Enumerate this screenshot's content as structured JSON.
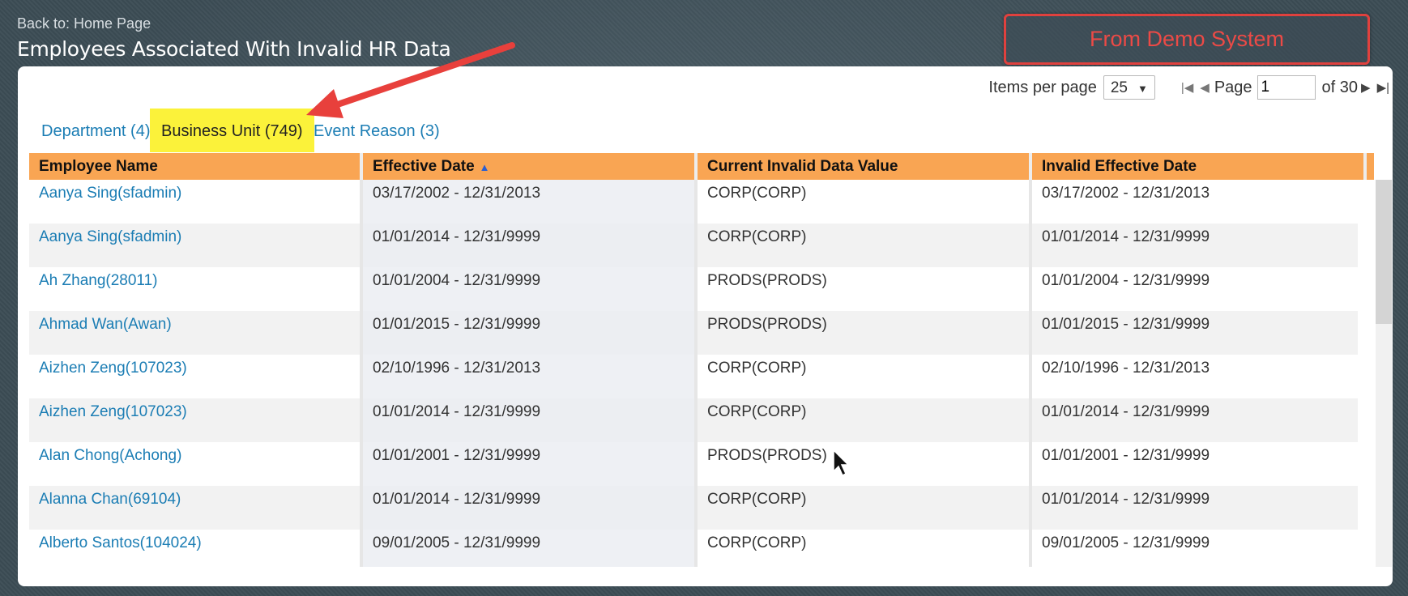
{
  "header": {
    "back_link": "Back to: Home Page",
    "title": "Employees Associated With Invalid HR Data",
    "banner": "From Demo System"
  },
  "pager": {
    "items_per_page_label": "Items per page",
    "items_per_page_value": "25",
    "page_label": "Page",
    "page_value": "1",
    "of_label": "of 30"
  },
  "tabs": [
    {
      "label": "Department (4)",
      "active": false
    },
    {
      "label": "Business Unit (749)",
      "active": true
    },
    {
      "label": "Event Reason (3)",
      "active": false
    }
  ],
  "table": {
    "columns": [
      "Employee Name",
      "Effective Date",
      "Current Invalid Data Value",
      "Invalid Effective Date"
    ],
    "sorted_column": "Effective Date",
    "sort_direction": "ascending",
    "rows": [
      [
        "Aanya Sing(sfadmin)",
        "03/17/2002 - 12/31/2013",
        "CORP(CORP)",
        "03/17/2002 - 12/31/2013"
      ],
      [
        "Aanya Sing(sfadmin)",
        "01/01/2014 - 12/31/9999",
        "CORP(CORP)",
        "01/01/2014 - 12/31/9999"
      ],
      [
        "Ah Zhang(28011)",
        "01/01/2004 - 12/31/9999",
        "PRODS(PRODS)",
        "01/01/2004 - 12/31/9999"
      ],
      [
        "Ahmad Wan(Awan)",
        "01/01/2015 - 12/31/9999",
        "PRODS(PRODS)",
        "01/01/2015 - 12/31/9999"
      ],
      [
        "Aizhen Zeng(107023)",
        "02/10/1996 - 12/31/2013",
        "CORP(CORP)",
        "02/10/1996 - 12/31/2013"
      ],
      [
        "Aizhen Zeng(107023)",
        "01/01/2014 - 12/31/9999",
        "CORP(CORP)",
        "01/01/2014 - 12/31/9999"
      ],
      [
        "Alan Chong(Achong)",
        "01/01/2001 - 12/31/9999",
        "PRODS(PRODS)",
        "01/01/2001 - 12/31/9999"
      ],
      [
        "Alanna Chan(69104)",
        "01/01/2014 - 12/31/9999",
        "CORP(CORP)",
        "01/01/2014 - 12/31/9999"
      ],
      [
        "Alberto Santos(104024)",
        "09/01/2005 - 12/31/9999",
        "CORP(CORP)",
        "09/01/2005 - 12/31/9999"
      ]
    ]
  },
  "colors": {
    "header_bg": "#f9a553",
    "active_tab_bg": "#fbf23a",
    "link": "#1b7db4",
    "banner": "#e0413e",
    "annotation_arrow": "#e8403c"
  },
  "icons": [
    "sort-ascending-icon",
    "first-page-icon",
    "prev-page-icon",
    "next-page-icon",
    "last-page-icon",
    "dropdown-arrow-icon",
    "mouse-cursor-icon",
    "annotation-arrow"
  ]
}
